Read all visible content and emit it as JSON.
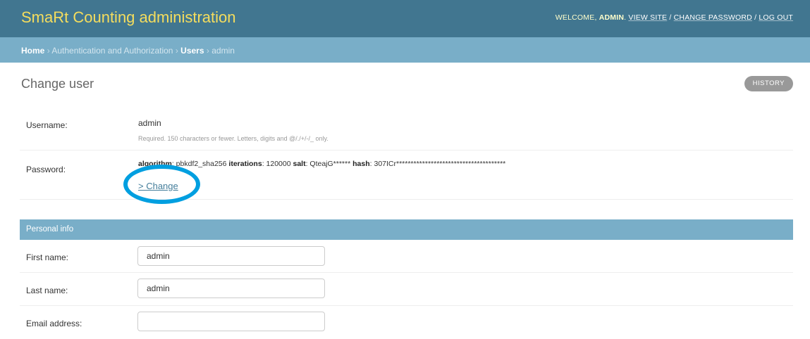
{
  "header": {
    "site_name": "SmaRt Counting administration",
    "welcome": "WELCOME,",
    "username": "ADMIN",
    "view_site": "VIEW SITE",
    "change_password": "CHANGE PASSWORD",
    "log_out": "LOG OUT",
    "separator": "/"
  },
  "breadcrumbs": {
    "home": "Home",
    "section": "Authentication and Authorization",
    "users": "Users",
    "current": "admin",
    "separator": "›"
  },
  "page": {
    "title": "Change user",
    "history_button": "HISTORY"
  },
  "form": {
    "username": {
      "label": "Username:",
      "value": "admin",
      "help": "Required. 150 characters or fewer. Letters, digits and @/./+/-/_ only."
    },
    "password": {
      "label": "Password:",
      "algorithm_label": "algorithm",
      "algorithm_value": ": pbkdf2_sha256 ",
      "iterations_label": "iterations",
      "iterations_value": ": 120000 ",
      "salt_label": "salt",
      "salt_value": ": QteajG****** ",
      "hash_label": "hash",
      "hash_value": ": 307ICr**************************************",
      "change_link": "> Change"
    },
    "personal_info": {
      "title": "Personal info",
      "first_name": {
        "label": "First name:",
        "value": "admin"
      },
      "last_name": {
        "label": "Last name:",
        "value": "admin"
      },
      "email": {
        "label": "Email address:",
        "value": ""
      }
    }
  },
  "colors": {
    "header_bg": "#417690",
    "breadcrumb_bg": "#79aec8",
    "brand_text": "#f5dd5d",
    "highlight_ring": "#009fe0"
  }
}
